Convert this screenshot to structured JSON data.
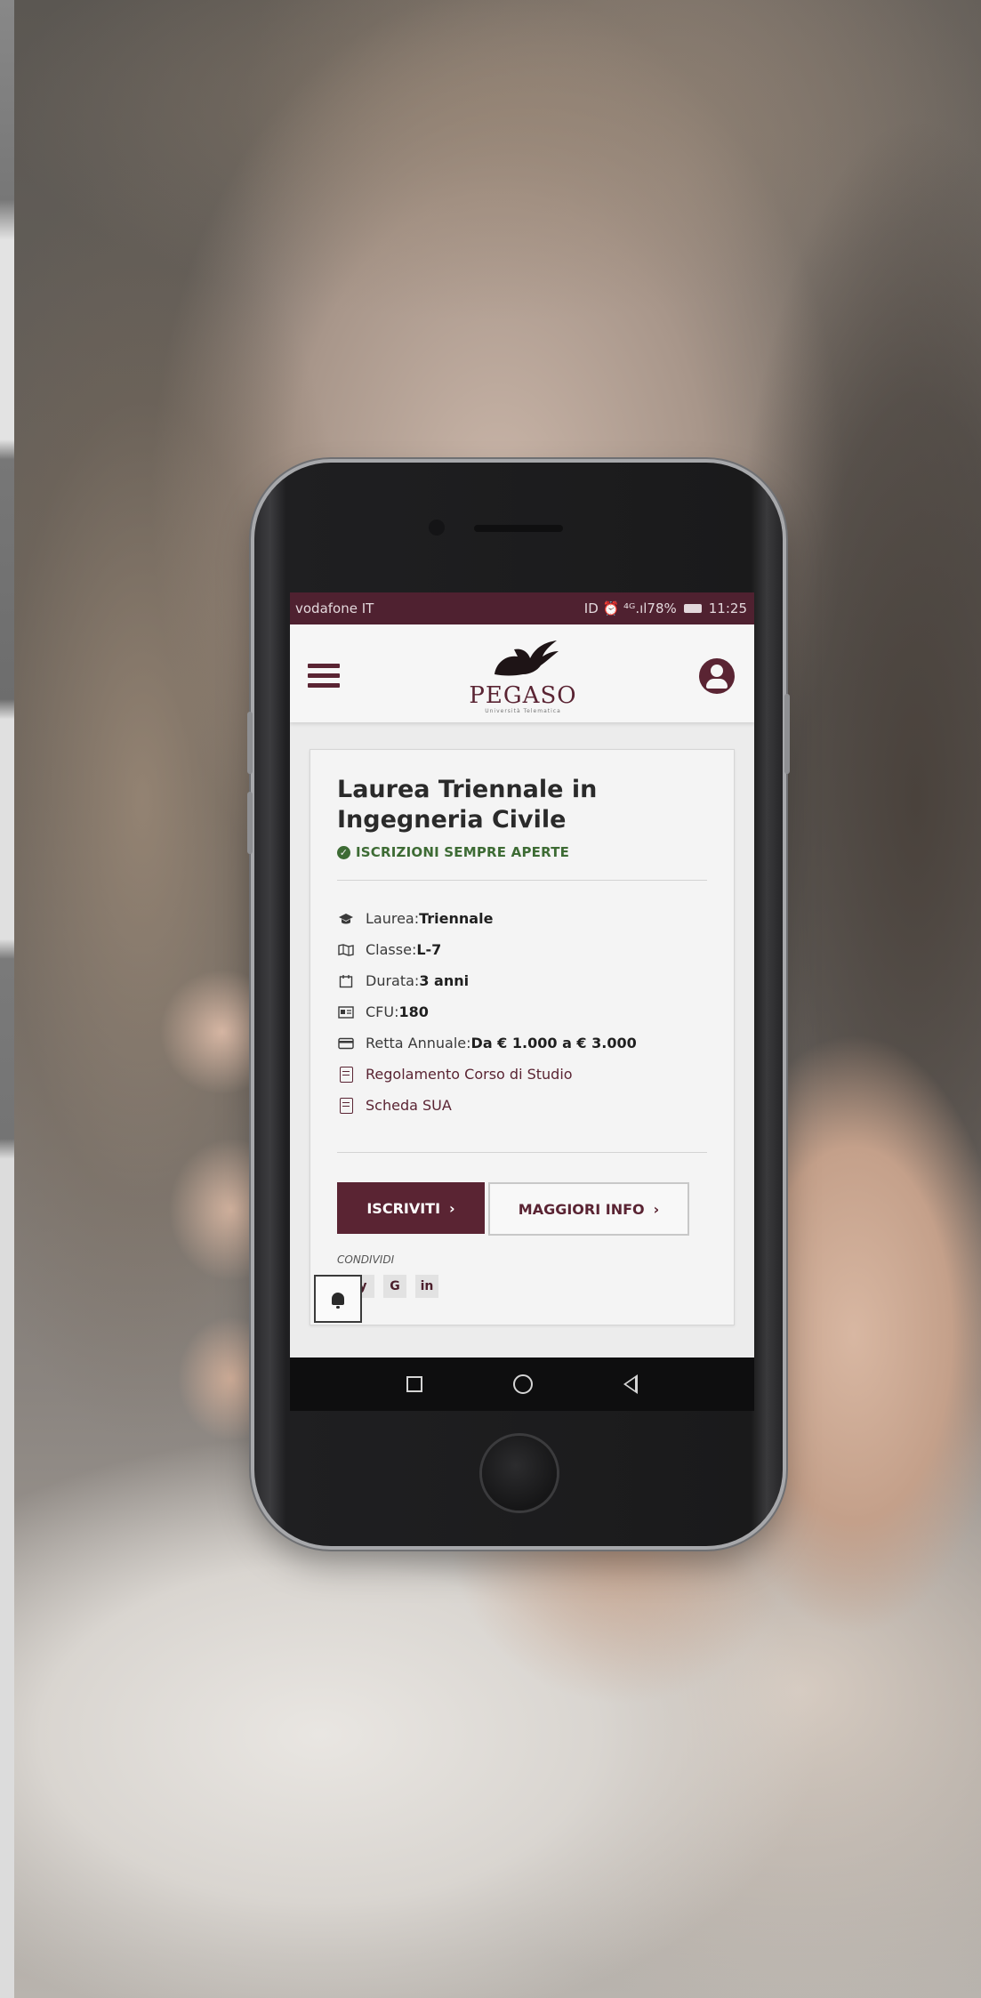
{
  "statusbar": {
    "carrier": "vodafone IT",
    "icons_text": "ID ⏰ ⁴ᴳ.ıl78%",
    "time": "11:25"
  },
  "header": {
    "brand": "PEGASO",
    "tagline": "Università Telematica",
    "menu_icon": "hamburger-menu-icon",
    "profile_icon": "user-profile-icon"
  },
  "course": {
    "title": "Laurea Triennale in Ingegneria Civile",
    "status": "ISCRIZIONI SEMPRE APERTE",
    "details": [
      {
        "icon": "graduation-cap-icon",
        "label": "Laurea: ",
        "value": "Triennale"
      },
      {
        "icon": "map-icon",
        "label": "Classe: ",
        "value": "L-7"
      },
      {
        "icon": "calendar-icon",
        "label": "Durata: ",
        "value": "3 anni"
      },
      {
        "icon": "id-card-icon",
        "label": "CFU: ",
        "value": "180"
      },
      {
        "icon": "credit-card-icon",
        "label": "Retta Annuale: ",
        "value": "Da € 1.000 a € 3.000"
      }
    ],
    "links": [
      {
        "icon": "document-icon",
        "label": "Regolamento Corso di Studio"
      },
      {
        "icon": "document-icon",
        "label": "Scheda SUA"
      }
    ],
    "primary_button": "ISCRIVITI",
    "secondary_button": "MAGGIORI INFO",
    "share_label": "CONDIVIDI",
    "share": [
      "y",
      "G",
      "in"
    ]
  },
  "colors": {
    "brand": "#5a2433",
    "status_green": "#3d6b34"
  }
}
